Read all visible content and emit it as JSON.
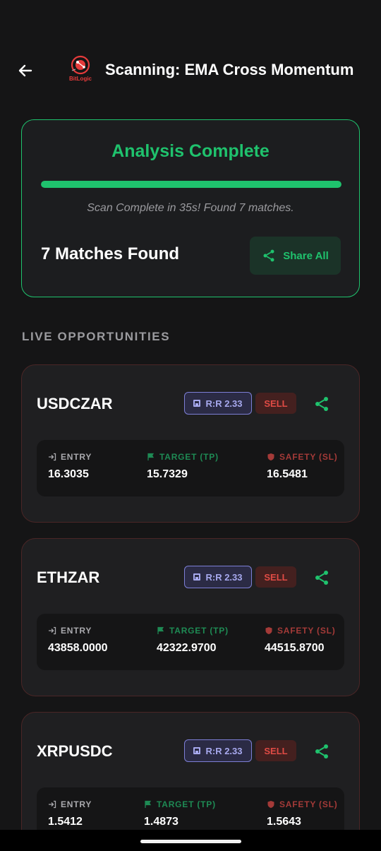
{
  "header": {
    "title": "Scanning: EMA Cross Momentum",
    "logo_text": "BitLogic"
  },
  "status": {
    "title": "Analysis Complete",
    "progress": 1.0,
    "subtitle": "Scan Complete in 35s! Found 7 matches.",
    "matches_label": "7 Matches Found",
    "share_all_label": "Share All"
  },
  "section_label": "LIVE OPPORTUNITIES",
  "labels": {
    "entry": "ENTRY",
    "target": "TARGET (TP)",
    "safety": "SAFETY (SL)"
  },
  "opportunities": [
    {
      "pair": "USDCZAR",
      "rr": "R:R 2.33",
      "side": "SELL",
      "entry": "16.3035",
      "target": "15.7329",
      "safety": "16.5481"
    },
    {
      "pair": "ETHZAR",
      "rr": "R:R 2.33",
      "side": "SELL",
      "entry": "43858.0000",
      "target": "42322.9700",
      "safety": "44515.8700"
    },
    {
      "pair": "XRPUSDC",
      "rr": "R:R 2.33",
      "side": "SELL",
      "entry": "1.5412",
      "target": "1.4873",
      "safety": "1.5643"
    }
  ],
  "colors": {
    "accent_green": "#1fc26d",
    "sell_red": "#e04b45",
    "rr_purple": "#a7a9ee",
    "background": "#151516"
  },
  "icons": [
    "back-arrow-icon",
    "share-icon",
    "entry-icon",
    "flag-icon",
    "shield-icon",
    "rr-chart-icon"
  ]
}
